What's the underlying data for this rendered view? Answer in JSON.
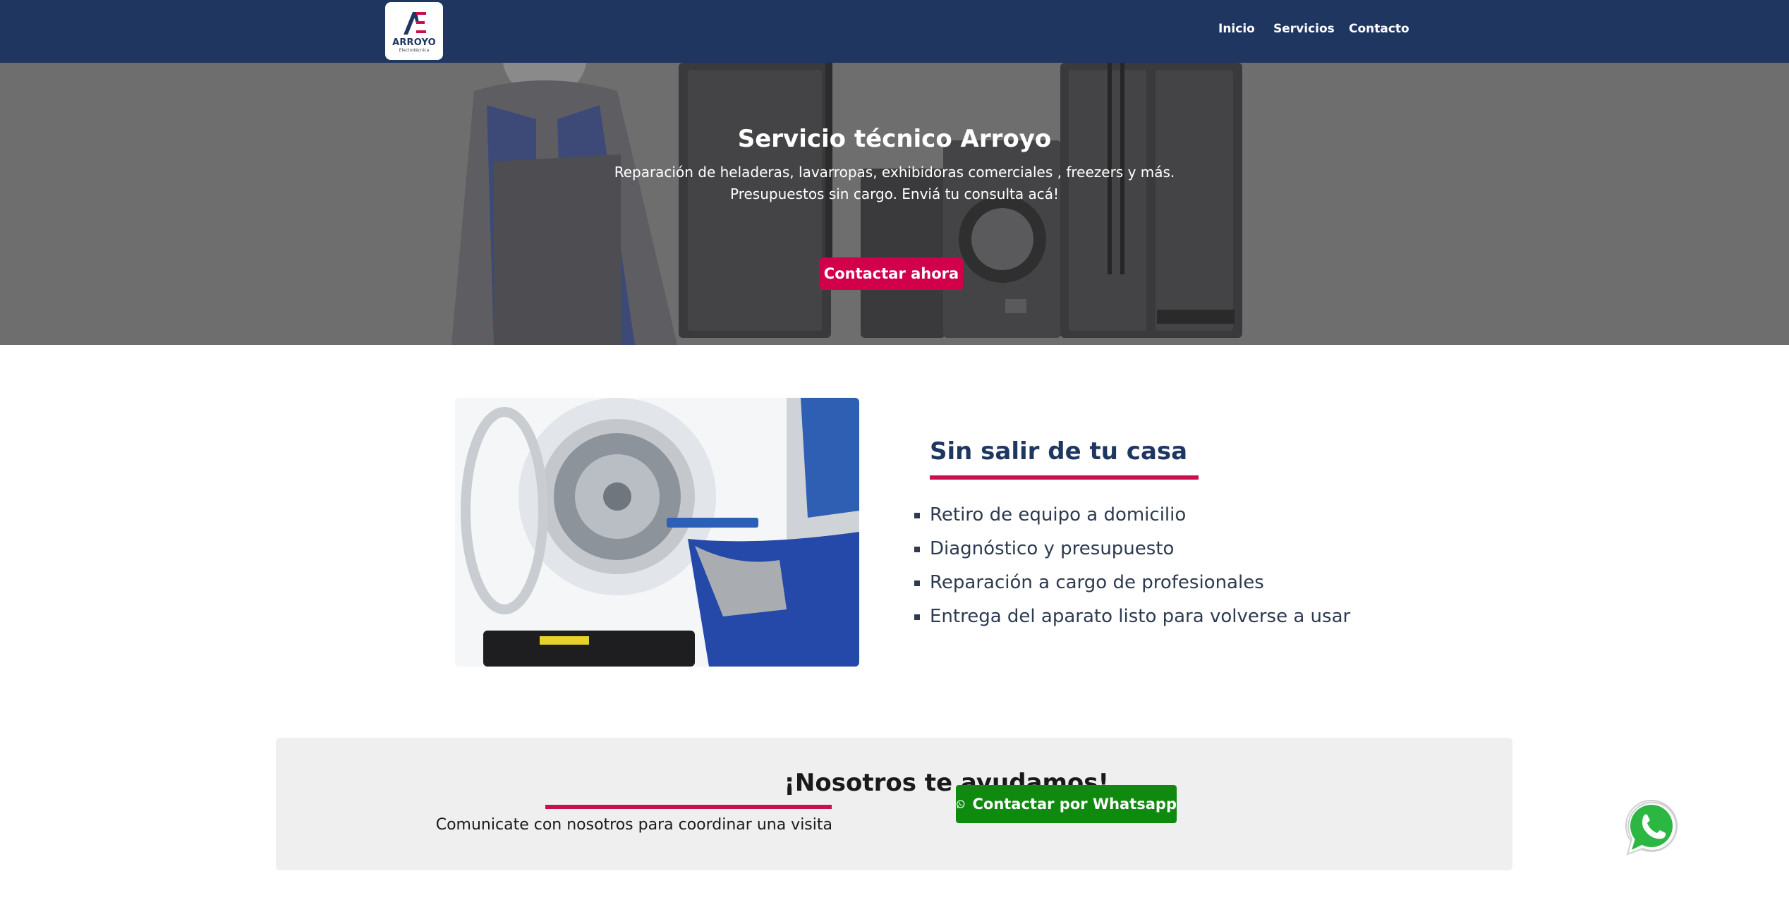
{
  "header": {
    "logo_text": "ARROYO",
    "logo_subtext": "Electrotécnica",
    "nav": [
      {
        "label": "Inicio"
      },
      {
        "label": "Servicios"
      },
      {
        "label": "Contacto"
      }
    ]
  },
  "hero": {
    "title": "Servicio técnico Arroyo",
    "line1": "Reparación de heladeras, lavarropas, exhibidoras comerciales , freezers y más.",
    "line2": "Presupuestos sin cargo. Enviá tu consulta acá!",
    "button_label": "Contactar ahora"
  },
  "features": {
    "title": "Sin salir de tu casa",
    "items": [
      "Retiro de equipo a domicilio",
      "Diagnóstico y presupuesto",
      "Reparación a cargo de profesionales",
      "Entrega del aparato listo para volverse a usar"
    ]
  },
  "cta": {
    "title": "¡Nosotros te ayudamos!",
    "text": "Comunicate con nosotros para coordinar una visita",
    "whatsapp_label": "Contactar por Whatsapp"
  },
  "colors": {
    "header_bg": "#1f3661",
    "accent": "#d2004b",
    "whatsapp_green": "#0f8a0f"
  },
  "icons": {
    "whatsapp_button": "whatsapp-icon",
    "floating": "whatsapp-icon"
  }
}
